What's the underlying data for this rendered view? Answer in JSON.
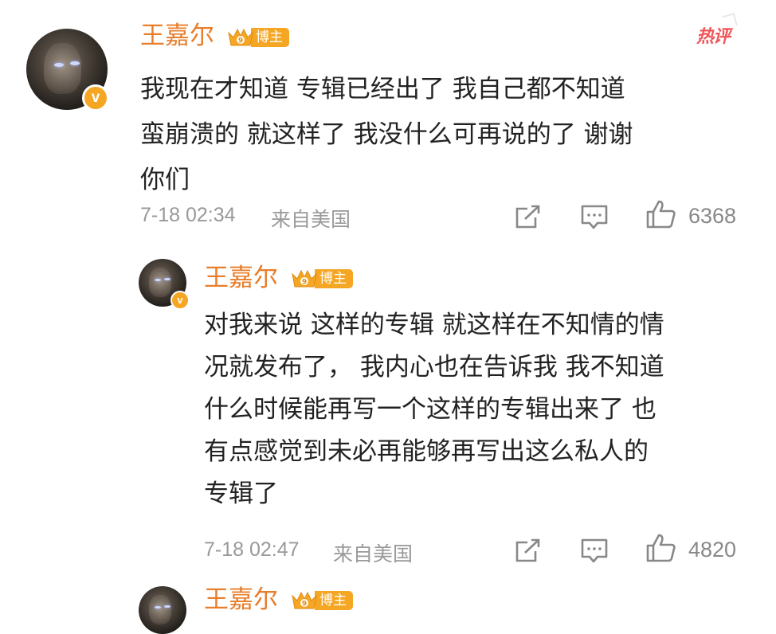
{
  "hot_label": "热评",
  "comments": [
    {
      "username": "王嘉尔",
      "badge": "博主",
      "text": "我现在才知道 专辑已经出了 我自己都不知道\n蛮崩溃的  就这样了 我没什么可再说的了  谢谢\n你们",
      "time": "7-18 02:34",
      "location": "来自美国",
      "likes": "6368"
    },
    {
      "username": "王嘉尔",
      "badge": "博主",
      "text": "对我来说 这样的专辑 就这样在不知情的情\n况就发布了，  我内心也在告诉我 我不知道\n什么时候能再写一个这样的专辑出来了 也\n有点感觉到未必再能够再写出这么私人的\n专辑了",
      "time": "7-18 02:47",
      "location": "来自美国",
      "likes": "4820"
    },
    {
      "username": "王嘉尔",
      "badge": "博主"
    }
  ],
  "colors": {
    "username": "#e87d2a",
    "badge": "#f5a623",
    "hot": "#f0565a",
    "meta": "#999999"
  },
  "icons": [
    "share-icon",
    "comment-icon",
    "like-icon",
    "verified-icon",
    "crown-icon"
  ]
}
